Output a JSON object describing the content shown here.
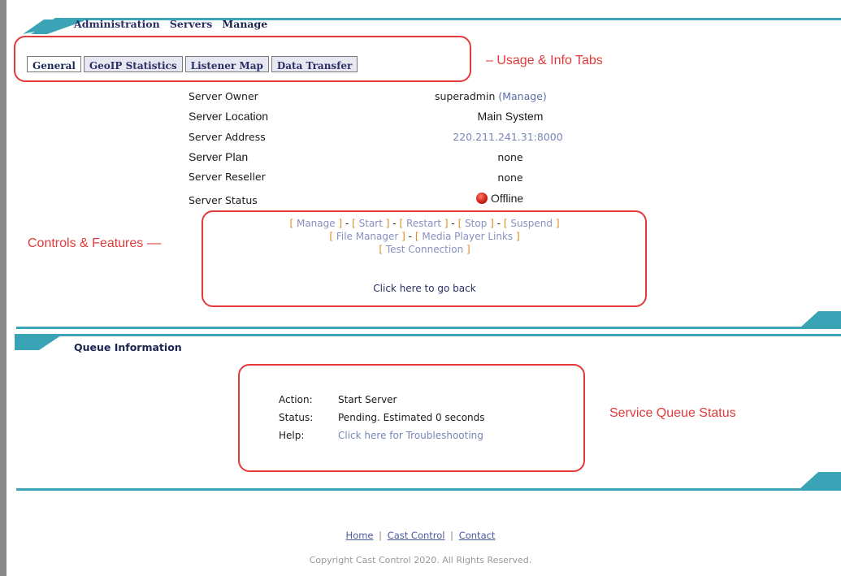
{
  "nav": {
    "administration": "Administration",
    "servers": "Servers",
    "manage": "Manage"
  },
  "tabs": [
    {
      "label": "General",
      "active": true
    },
    {
      "label": "GeoIP Statistics",
      "active": false
    },
    {
      "label": "Listener Map",
      "active": false
    },
    {
      "label": "Data Transfer",
      "active": false
    }
  ],
  "annotations": {
    "tabs": "– Usage & Info Tabs",
    "controls": "Controls & Features ––",
    "queue": "Service Queue Status"
  },
  "server_info": {
    "owner_label": "Server Owner",
    "owner_value": "superadmin",
    "owner_manage": "(Manage)",
    "location_label": "Server Location",
    "location_value": "Main System",
    "address_label": "Server Address",
    "address_value": "220.211.241.31:8000",
    "plan_label": "Server Plan",
    "plan_value": "none",
    "reseller_label": "Server Reseller",
    "reseller_value": "none",
    "status_label": "Server Status",
    "status_value": "Offline"
  },
  "controls": {
    "manage": "Manage",
    "start": "Start",
    "restart": "Restart",
    "stop": "Stop",
    "suspend": "Suspend",
    "file_manager": "File Manager",
    "media_player_links": "Media Player Links",
    "test_connection": "Test Connection",
    "go_back": "Click here to go back"
  },
  "queue": {
    "title": "Queue Information",
    "action_label": "Action:",
    "action_value": "Start Server",
    "status_label": "Status:",
    "status_value": "Pending. Estimated 0 seconds",
    "help_label": "Help:",
    "help_value": "Click here for Troubleshooting"
  },
  "footer": {
    "home": "Home",
    "cast_control": "Cast Control",
    "contact": "Contact",
    "separator": "|",
    "copyright": "Copyright Cast Control 2020. All Rights Reserved."
  },
  "colors": {
    "accent": "#3aa3b5",
    "annotation": "#e23a3a",
    "nav": "#2a2f66",
    "offline": "#d1221a"
  }
}
